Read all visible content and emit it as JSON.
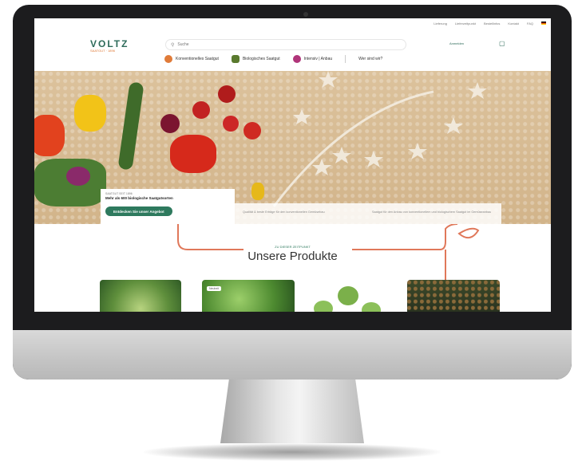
{
  "colors": {
    "brand_green": "#2e7a5e",
    "accent_orange": "#e07b39",
    "sand": "#d6ba91"
  },
  "topbar": {
    "links": [
      "Lieferung",
      "Lieferzeitpunkt",
      "Bestellinfos",
      "Kontakt",
      "FAQ"
    ]
  },
  "logo": {
    "main": "VOLTZ",
    "sub": "SAATGUT · 1896"
  },
  "search": {
    "placeholder": "Suche",
    "icon": "search-icon"
  },
  "account": {
    "login": "Anmelden",
    "cart_icon": "cart-icon"
  },
  "nav": {
    "items": [
      "Konventionelles Saatgut",
      "Biologisches Saatgut",
      "Intensiv | Anbau"
    ],
    "extra": "Wer sind wir?"
  },
  "hero": {
    "card_label": "SAATGUT SEIT 1896",
    "card_title": "Mehr als 600 biologische Saatgutsorten",
    "cta": "Entdecken Sie unser Angebot",
    "strip_left": "Qualität & beste Erträge für den konventionellen Gemüsebau",
    "strip_right": "Saatgut für den Anbau von konventionellem und biologischem Saatgut im Gemüseanbau"
  },
  "products": {
    "subtitle": "ZU DIESER ZEITPUNKT",
    "title": "Unsere Produkte",
    "badge": "Neuheit"
  }
}
